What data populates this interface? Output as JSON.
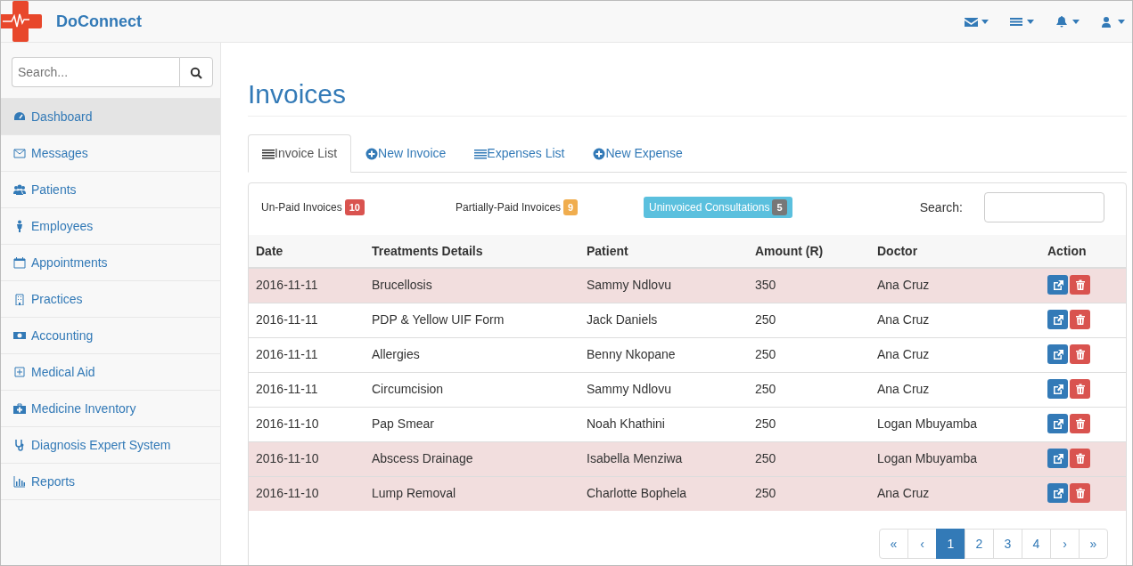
{
  "brand": "DoConnect",
  "sidebar": {
    "search": {
      "placeholder": "Search..."
    },
    "items": [
      {
        "label": "Dashboard",
        "selected": true
      },
      {
        "label": "Messages",
        "selected": false
      },
      {
        "label": "Patients",
        "selected": false
      },
      {
        "label": "Employees",
        "selected": false
      },
      {
        "label": "Appointments",
        "selected": false
      },
      {
        "label": "Practices",
        "selected": false
      },
      {
        "label": "Accounting",
        "selected": false
      },
      {
        "label": "Medical Aid",
        "selected": false
      },
      {
        "label": "Medicine Inventory",
        "selected": false
      },
      {
        "label": "Diagnosis Expert System",
        "selected": false
      },
      {
        "label": "Reports",
        "selected": false
      }
    ]
  },
  "page_title": "Invoices",
  "tabs": [
    {
      "label": "Invoice List",
      "selected": true
    },
    {
      "label": "New Invoice",
      "selected": false
    },
    {
      "label": "Expenses List",
      "selected": false
    },
    {
      "label": "New Expense",
      "selected": false
    }
  ],
  "filters": [
    {
      "label": "Un-Paid Invoices",
      "count": "10",
      "color": "#d9534f",
      "selected": false
    },
    {
      "label": "Partially-Paid Invoices",
      "count": "9",
      "color": "#f0ad4e",
      "selected": false
    },
    {
      "label": "Uninvoiced Consultations",
      "count": "5",
      "color": "#777777",
      "selected": true
    }
  ],
  "search": {
    "label": "Search:"
  },
  "table": {
    "columns": [
      "Date",
      "Treatments Details",
      "Patient",
      "Amount (R)",
      "Doctor",
      "Action"
    ],
    "rows": [
      {
        "cells": [
          "2016-11-11",
          "Brucellosis",
          "Sammy Ndlovu",
          "350",
          "Ana Cruz"
        ],
        "highlighted": true
      },
      {
        "cells": [
          "2016-11-11",
          "PDP & Yellow UIF Form",
          "Jack Daniels",
          "250",
          "Ana Cruz"
        ],
        "highlighted": false
      },
      {
        "cells": [
          "2016-11-11",
          "Allergies",
          "Benny Nkopane",
          "250",
          "Ana Cruz"
        ],
        "highlighted": false
      },
      {
        "cells": [
          "2016-11-11",
          "Circumcision",
          "Sammy Ndlovu",
          "250",
          "Ana Cruz"
        ],
        "highlighted": false
      },
      {
        "cells": [
          "2016-11-10",
          "Pap Smear",
          "Noah Khathini",
          "250",
          "Logan Mbuyamba"
        ],
        "highlighted": false
      },
      {
        "cells": [
          "2016-11-10",
          "Abscess Drainage",
          "Isabella Menziwa",
          "250",
          "Logan Mbuyamba"
        ],
        "highlighted": true
      },
      {
        "cells": [
          "2016-11-10",
          "Lump Removal",
          "Charlotte Bophela",
          "250",
          "Ana Cruz"
        ],
        "highlighted": true
      }
    ]
  },
  "pagination": [
    {
      "label": "«",
      "selected": false
    },
    {
      "label": "‹",
      "selected": false
    },
    {
      "label": "1",
      "selected": true
    },
    {
      "label": "2",
      "selected": false
    },
    {
      "label": "3",
      "selected": false
    },
    {
      "label": "4",
      "selected": false
    },
    {
      "label": "›",
      "selected": false
    },
    {
      "label": "»",
      "selected": false
    }
  ]
}
